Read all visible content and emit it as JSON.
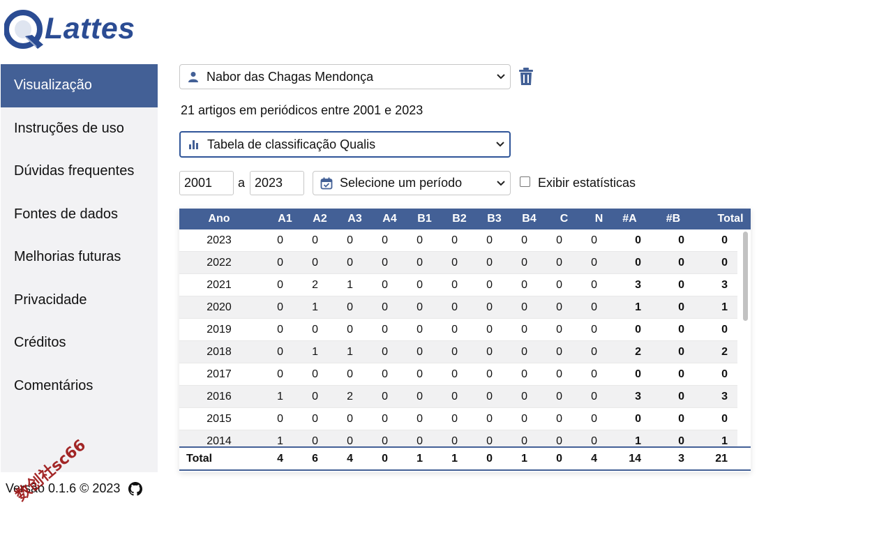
{
  "logo": {
    "text": "Lattes",
    "brand_color": "#2b4c93"
  },
  "sidebar": {
    "items": [
      {
        "label": "Visualização",
        "active": true
      },
      {
        "label": "Instruções de uso"
      },
      {
        "label": "Dúvidas frequentes"
      },
      {
        "label": "Fontes de dados"
      },
      {
        "label": "Melhorias futuras"
      },
      {
        "label": "Privacidade"
      },
      {
        "label": "Créditos"
      },
      {
        "label": "Comentários"
      }
    ],
    "active_color": "#436096"
  },
  "footer": {
    "version": "Versão 0.1.6 © 2023",
    "stamp": "数创社sc66"
  },
  "researcher_select": {
    "value": "Nabor das Chagas Mendonça",
    "icon": "user-icon"
  },
  "summary": "21 artigos em periódicos entre 2001 e 2023",
  "view_select": {
    "value": "Tabela de classificação Qualis",
    "icon": "bar-chart-icon"
  },
  "period": {
    "from": "2001",
    "separator": "a",
    "to": "2023",
    "preset_placeholder": "Selecione um período",
    "icon": "calendar-icon"
  },
  "stats_checkbox": {
    "label": "Exibir estatísticas",
    "checked": false
  },
  "table": {
    "headers": [
      "Ano",
      "A1",
      "A2",
      "A3",
      "A4",
      "B1",
      "B2",
      "B3",
      "B4",
      "C",
      "N",
      "#A",
      "#B",
      "Total"
    ],
    "rows": [
      [
        "2023",
        "0",
        "0",
        "0",
        "0",
        "0",
        "0",
        "0",
        "0",
        "0",
        "0",
        "0",
        "0",
        "0"
      ],
      [
        "2022",
        "0",
        "0",
        "0",
        "0",
        "0",
        "0",
        "0",
        "0",
        "0",
        "0",
        "0",
        "0",
        "0"
      ],
      [
        "2021",
        "0",
        "2",
        "1",
        "0",
        "0",
        "0",
        "0",
        "0",
        "0",
        "0",
        "3",
        "0",
        "3"
      ],
      [
        "2020",
        "0",
        "1",
        "0",
        "0",
        "0",
        "0",
        "0",
        "0",
        "0",
        "0",
        "1",
        "0",
        "1"
      ],
      [
        "2019",
        "0",
        "0",
        "0",
        "0",
        "0",
        "0",
        "0",
        "0",
        "0",
        "0",
        "0",
        "0",
        "0"
      ],
      [
        "2018",
        "0",
        "1",
        "1",
        "0",
        "0",
        "0",
        "0",
        "0",
        "0",
        "0",
        "2",
        "0",
        "2"
      ],
      [
        "2017",
        "0",
        "0",
        "0",
        "0",
        "0",
        "0",
        "0",
        "0",
        "0",
        "0",
        "0",
        "0",
        "0"
      ],
      [
        "2016",
        "1",
        "0",
        "2",
        "0",
        "0",
        "0",
        "0",
        "0",
        "0",
        "0",
        "3",
        "0",
        "3"
      ],
      [
        "2015",
        "0",
        "0",
        "0",
        "0",
        "0",
        "0",
        "0",
        "0",
        "0",
        "0",
        "0",
        "0",
        "0"
      ],
      [
        "2014",
        "1",
        "0",
        "0",
        "0",
        "0",
        "0",
        "0",
        "0",
        "0",
        "0",
        "1",
        "0",
        "1"
      ]
    ],
    "totals": [
      "Total",
      "4",
      "6",
      "4",
      "0",
      "1",
      "1",
      "0",
      "1",
      "0",
      "4",
      "14",
      "3",
      "21"
    ],
    "header_color": "#436096"
  }
}
